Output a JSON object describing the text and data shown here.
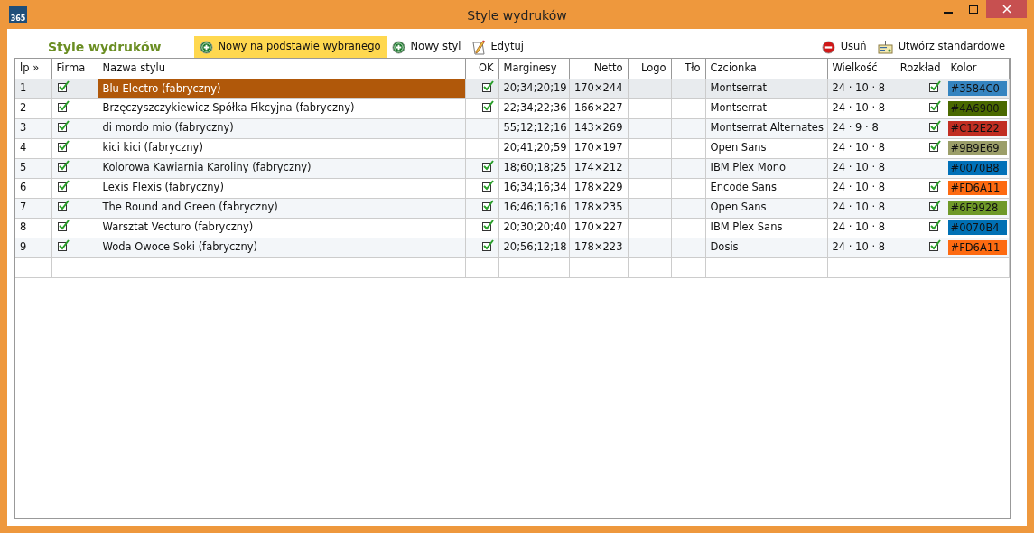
{
  "window": {
    "title": "Style wydruków",
    "app_icon_text": "365"
  },
  "heading": "Style wydruków",
  "toolbar_left": [
    {
      "label": "Nowy na podstawie wybranego",
      "kind": "add",
      "highlighted": true
    },
    {
      "label": "Nowy styl",
      "kind": "add",
      "highlighted": false
    },
    {
      "label": "Edytuj",
      "kind": "edit",
      "highlighted": false
    }
  ],
  "toolbar_right": [
    {
      "label": "Usuń",
      "kind": "remove",
      "highlighted": false
    },
    {
      "label": "Utwórz standardowe",
      "kind": "standard",
      "highlighted": false
    }
  ],
  "table": {
    "columns": [
      "lp »",
      "Firma",
      "Nazwa stylu",
      "OK",
      "Marginesy",
      "Netto",
      "Logo",
      "Tło",
      "Czcionka",
      "Wielkość",
      "Rozkład",
      "Kolor"
    ],
    "rows": [
      {
        "lp": "1",
        "firma": true,
        "name": "Blu Electro (fabryczny)",
        "ok": true,
        "margins": "20;34;20;19",
        "netto": "170×244",
        "font": "Montserrat",
        "size": "24 · 10 · 8",
        "layout": true,
        "color": "#3584c0",
        "color_text": "#3584C0",
        "selected": true
      },
      {
        "lp": "2",
        "firma": true,
        "name": "Brzęczyszczykiewicz Spółka Fikcyjna (fabryczny)",
        "ok": true,
        "margins": "22;34;22;36",
        "netto": "166×227",
        "font": "Montserrat",
        "size": "24 · 10 · 8",
        "layout": true,
        "color": "#4a6900",
        "color_text": "#4A6900",
        "selected": false
      },
      {
        "lp": "3",
        "firma": true,
        "name": "di mordo mio (fabryczny)",
        "ok": false,
        "margins": "55;12;12;16",
        "netto": "143×269",
        "font": "Montserrat Alternates",
        "size": "24 · 9 · 8",
        "layout": true,
        "color": "#c12e22",
        "color_text": "#C12E22",
        "selected": false
      },
      {
        "lp": "4",
        "firma": true,
        "name": "kici kici (fabryczny)",
        "ok": false,
        "margins": "20;41;20;59",
        "netto": "170×197",
        "font": "Open Sans",
        "size": "24 · 10 · 8",
        "layout": true,
        "color": "#9b9e69",
        "color_text": "#9B9E69",
        "selected": false
      },
      {
        "lp": "5",
        "firma": true,
        "name": "Kolorowa Kawiarnia Karoliny (fabryczny)",
        "ok": true,
        "margins": "18;60;18;25",
        "netto": "174×212",
        "font": "IBM Plex Mono",
        "size": "24 · 10 · 8",
        "layout": false,
        "color": "#0070b8",
        "color_text": "#0070B8",
        "selected": false
      },
      {
        "lp": "6",
        "firma": true,
        "name": "Lexis Flexis (fabryczny)",
        "ok": true,
        "margins": "16;34;16;34",
        "netto": "178×229",
        "font": "Encode Sans",
        "size": "24 · 10 · 8",
        "layout": true,
        "color": "#fd6a11",
        "color_text": "#FD6A11",
        "selected": false
      },
      {
        "lp": "7",
        "firma": true,
        "name": "The Round and Green (fabryczny)",
        "ok": true,
        "margins": "16;46;16;16",
        "netto": "178×235",
        "font": "Open Sans",
        "size": "24 · 10 · 8",
        "layout": true,
        "color": "#6f9928",
        "color_text": "#6F9928",
        "selected": false
      },
      {
        "lp": "8",
        "firma": true,
        "name": "Warsztat Vecturo (fabryczny)",
        "ok": true,
        "margins": "20;30;20;40",
        "netto": "170×227",
        "font": "IBM Plex Sans",
        "size": "24 · 10 · 8",
        "layout": true,
        "color": "#0070b4",
        "color_text": "#0070B4",
        "selected": false
      },
      {
        "lp": "9",
        "firma": true,
        "name": "Woda Owoce Soki (fabryczny)",
        "ok": true,
        "margins": "20;56;12;18",
        "netto": "178×223",
        "font": "Dosis",
        "size": "24 · 10 · 8",
        "layout": true,
        "color": "#fd6a11",
        "color_text": "#FD6A11",
        "selected": false
      }
    ]
  }
}
